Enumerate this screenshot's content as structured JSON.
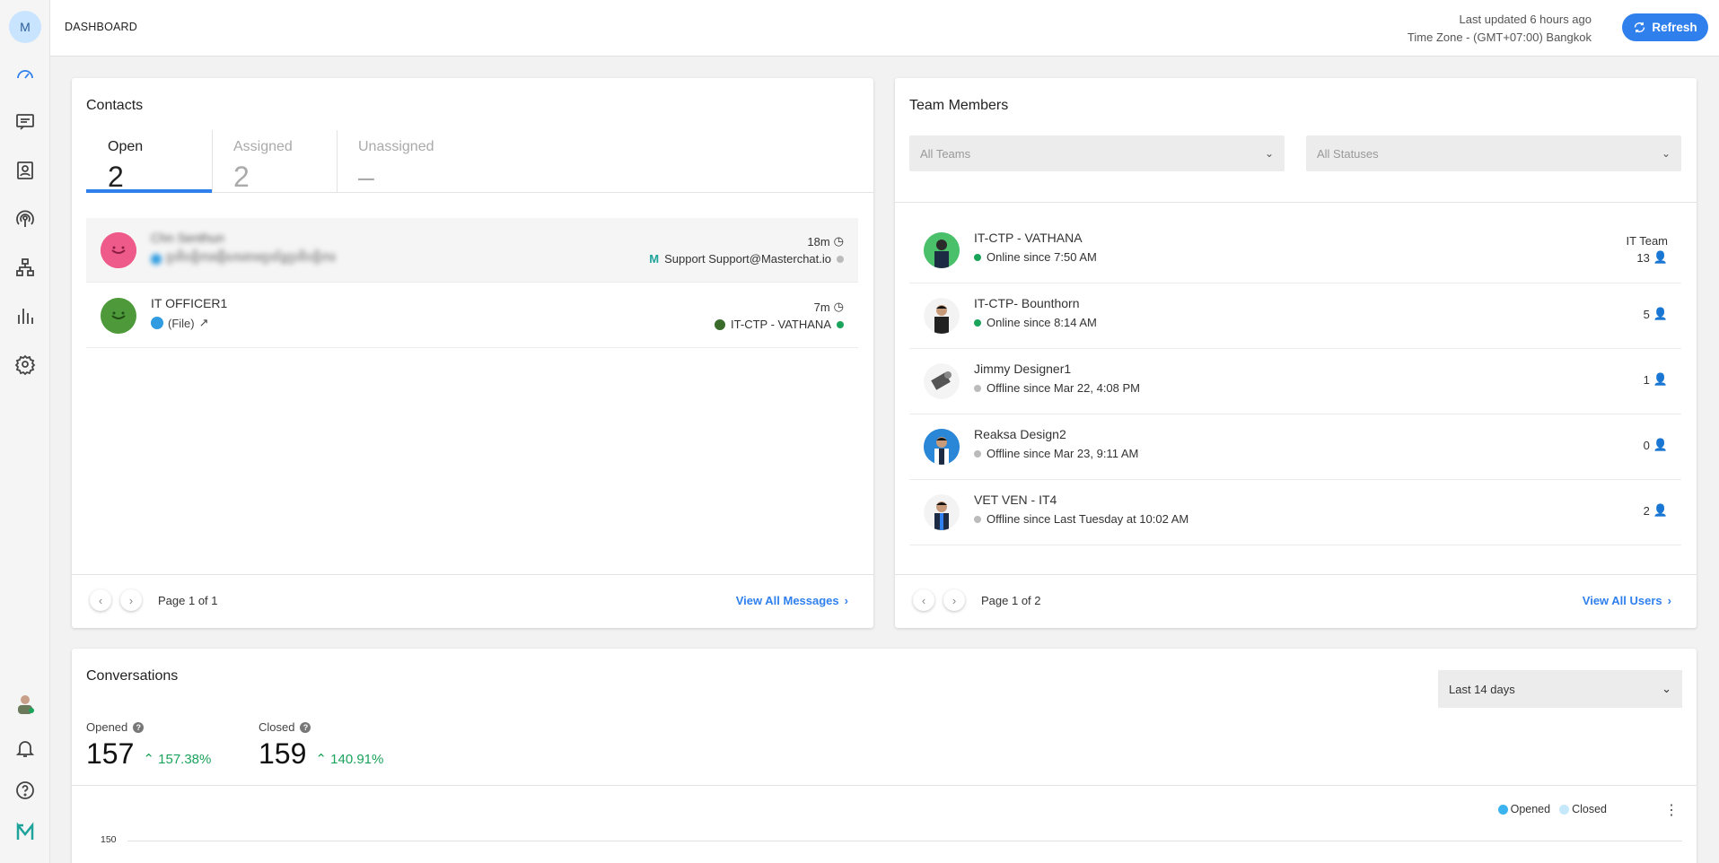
{
  "sidebar": {
    "user_initial": "M",
    "nav": [
      "dashboard-icon",
      "messages-icon",
      "contacts-icon",
      "broadcast-icon",
      "workflows-icon",
      "reports-icon",
      "settings-icon"
    ],
    "bottom": [
      "user-avatar",
      "bell-icon",
      "help-icon",
      "masterchat-logo"
    ]
  },
  "header": {
    "title": "DASHBOARD",
    "last_updated": "Last updated 6 hours ago",
    "timezone": "Time Zone - (GMT+07:00) Bangkok",
    "refresh_label": "Refresh"
  },
  "contacts": {
    "title": "Contacts",
    "tabs": [
      {
        "label": "Open",
        "count": "2"
      },
      {
        "label": "Assigned",
        "count": "2"
      },
      {
        "label": "Unassigned",
        "count": "–"
      }
    ],
    "rows": [
      {
        "name": "Chn Senthun",
        "message": "ប្រតិបត្តិការផ្ញើសារតាមប្រព័ន្ធប្រតិបត្តិការ",
        "time": "18m",
        "agent": "Support Support@Masterchat.io",
        "avatar_color": "#ee5a8a"
      },
      {
        "name": "IT OFFICER1",
        "message": "(File)",
        "time": "7m",
        "agent": "IT-CTP - VATHANA",
        "avatar_color": "#4e9a3a"
      }
    ],
    "page_text": "Page 1 of 1",
    "view_all": "View All Messages"
  },
  "team": {
    "title": "Team Members",
    "filter_team": "All Teams",
    "filter_status": "All Statuses",
    "members": [
      {
        "name": "IT-CTP - VATHANA",
        "status": "Online since 7:50 AM",
        "online": true,
        "team": "IT Team",
        "count": "13"
      },
      {
        "name": "IT-CTP- Bounthorn",
        "status": "Online since 8:14 AM",
        "online": true,
        "team": "",
        "count": "5"
      },
      {
        "name": "Jimmy Designer1",
        "status": "Offline since Mar 22, 4:08 PM",
        "online": false,
        "team": "",
        "count": "1"
      },
      {
        "name": "Reaksa Design2",
        "status": "Offline since Mar 23, 9:11 AM",
        "online": false,
        "team": "",
        "count": "0"
      },
      {
        "name": "VET VEN - IT4",
        "status": "Offline since Last Tuesday at 10:02 AM",
        "online": false,
        "team": "",
        "count": "2"
      }
    ],
    "page_text": "Page 1 of 2",
    "view_all": "View All Users"
  },
  "conversations": {
    "title": "Conversations",
    "period": "Last 14 days",
    "opened_label": "Opened",
    "opened_value": "157",
    "opened_change": "157.38%",
    "closed_label": "Closed",
    "closed_value": "159",
    "closed_change": "140.91%",
    "legend_opened": "Opened",
    "legend_closed": "Closed",
    "y_tick": "150",
    "colors": {
      "opened": "#3bb3f0",
      "closed": "#c5e8fb"
    }
  }
}
